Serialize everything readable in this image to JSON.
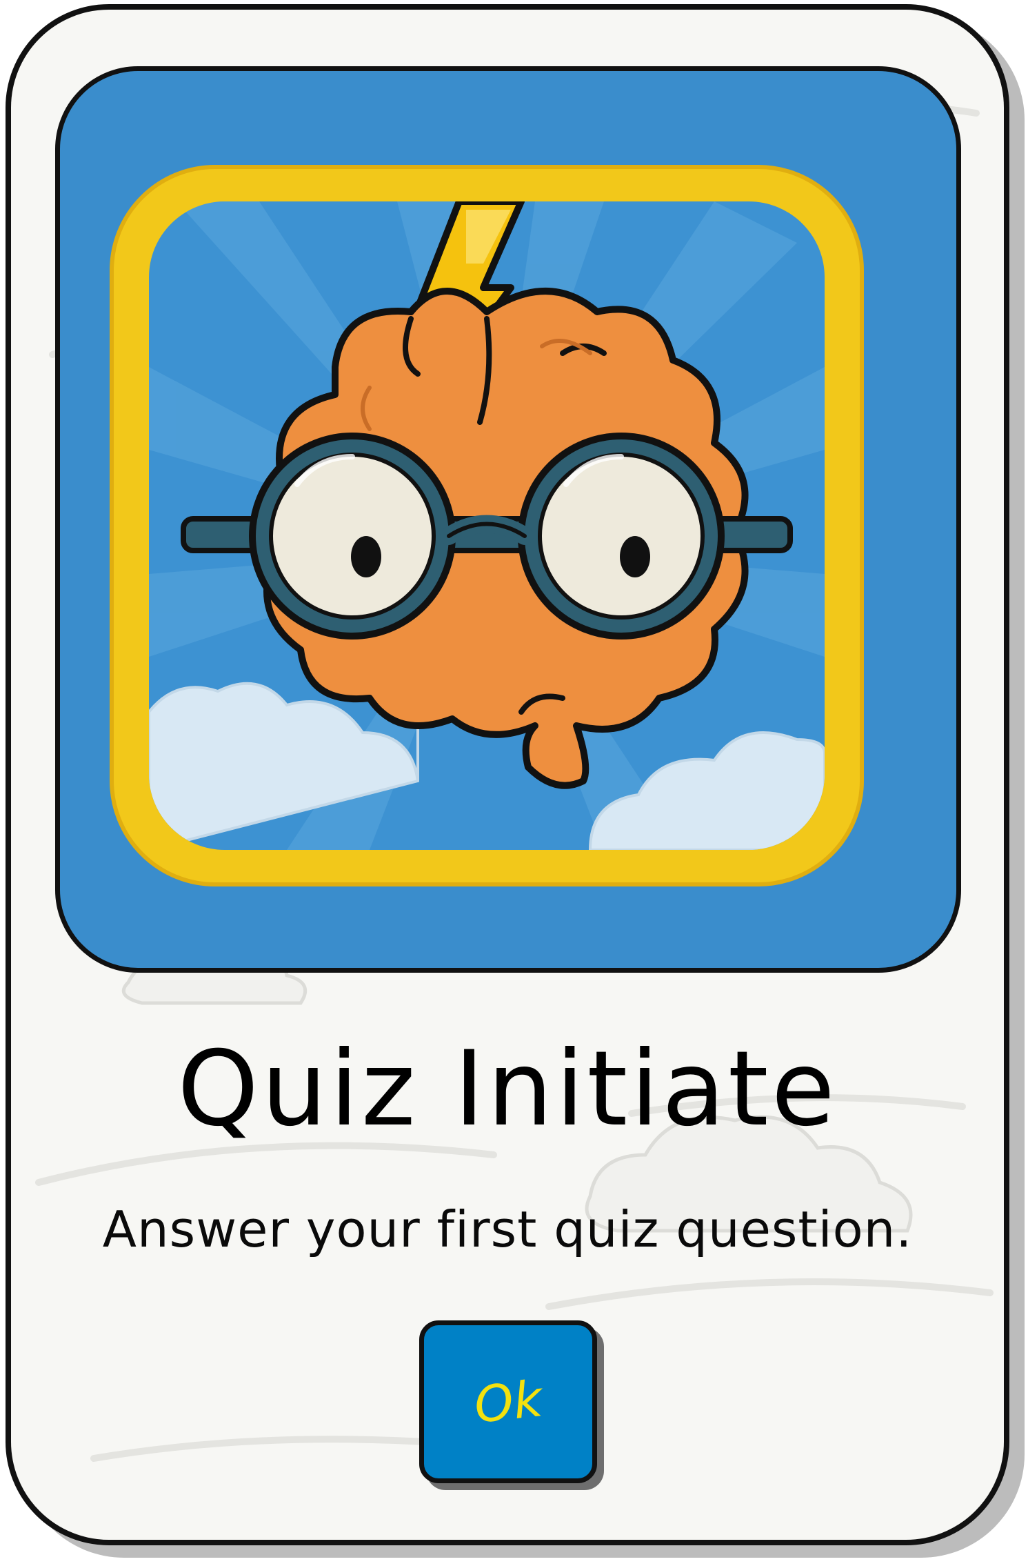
{
  "achievement": {
    "title": "Quiz Initiate",
    "description": "Answer your first quiz question.",
    "icon": "brain-with-glasses-lightning-icon"
  },
  "actions": {
    "ok_label": "Ok"
  },
  "colors": {
    "card_background": "#f7f7f4",
    "badge_blue": "#3a8dcc",
    "badge_gold": "#f2c81a",
    "brain_orange": "#ee8f3f",
    "button_blue": "#0081c6",
    "button_text": "#f3e10f"
  }
}
